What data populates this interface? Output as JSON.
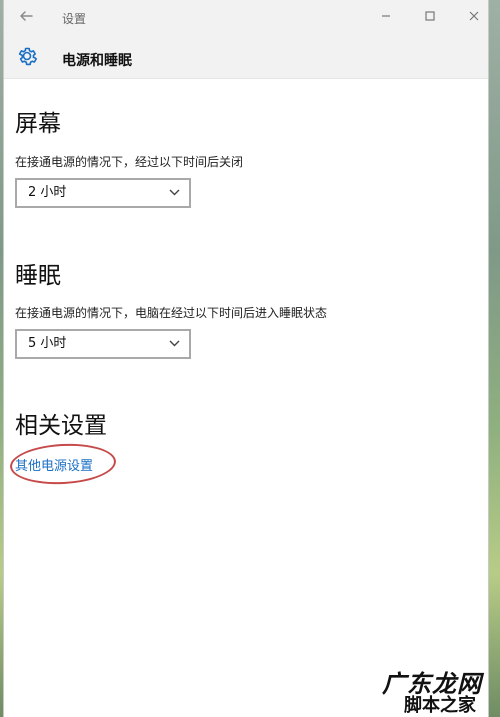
{
  "window": {
    "title": "设置",
    "back_icon": "back-arrow-icon",
    "controls": {
      "minimize_icon": "minimize-icon",
      "maximize_icon": "maximize-icon",
      "close_icon": "close-icon"
    }
  },
  "header": {
    "icon": "gear-icon",
    "title": "电源和睡眠"
  },
  "screen": {
    "title": "屏幕",
    "description": "在接通电源的情况下，经过以下时间后关闭",
    "select": {
      "value": "2 小时",
      "icon": "chevron-down-icon"
    }
  },
  "sleep": {
    "title": "睡眠",
    "description": "在接通电源的情况下，电脑在经过以下时间后进入睡眠状态",
    "select": {
      "value": "5 小时",
      "icon": "chevron-down-icon"
    }
  },
  "related": {
    "title": "相关设置",
    "link": "其他电源设置"
  },
  "watermark": {
    "line1": "广东龙网",
    "line2": "脚本之家"
  },
  "colors": {
    "link": "#1a6fc4",
    "highlight_circle": "#c74a4a",
    "accent_icon": "#1a6fc4"
  }
}
